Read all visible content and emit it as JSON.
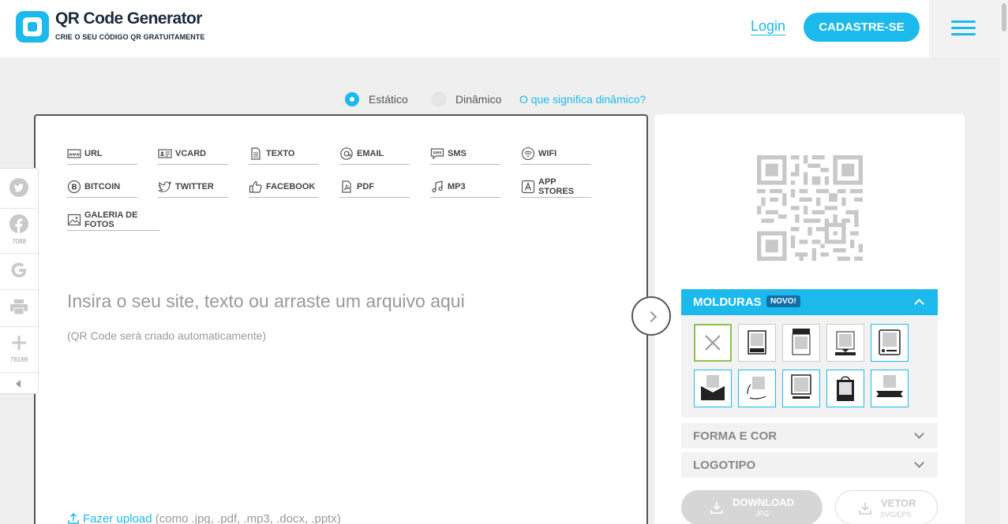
{
  "header": {
    "logo_title": "QR Code Generator",
    "logo_subtitle": "CRIE O SEU CÓDIGO QR GRATUITAMENTE",
    "login_label": "Login",
    "signup_label": "CADASTRE-SE",
    "accent_color": "#1cb9ec"
  },
  "mode": {
    "options": [
      "Estático",
      "Dinâmico"
    ],
    "selected": "Estático",
    "help_link": "O que significa dinâmico?"
  },
  "tabs": [
    {
      "label": "URL",
      "icon": "www-icon"
    },
    {
      "label": "VCARD",
      "icon": "vcard-icon"
    },
    {
      "label": "TEXTO",
      "icon": "document-icon"
    },
    {
      "label": "EMAIL",
      "icon": "at-icon"
    },
    {
      "label": "SMS",
      "icon": "sms-icon"
    },
    {
      "label": "WIFI",
      "icon": "wifi-icon"
    },
    {
      "label": "BITCOIN",
      "icon": "bitcoin-icon"
    },
    {
      "label": "TWITTER",
      "icon": "twitter-icon"
    },
    {
      "label": "FACEBOOK",
      "icon": "thumbs-up-icon"
    },
    {
      "label": "PDF",
      "icon": "pdf-icon"
    },
    {
      "label": "MP3",
      "icon": "music-note-icon"
    },
    {
      "label": "APP STORES",
      "icon": "app-store-icon"
    },
    {
      "label": "GALERIA DE FOTOS",
      "icon": "image-icon"
    }
  ],
  "editor": {
    "placeholder": "Insira o seu site, texto ou arraste um arquivo aqui",
    "subtext": "(QR Code será criado automaticamente)",
    "upload_link": "Fazer upload",
    "upload_hint": "(como .jpg, .pdf, .mp3, .docx, .pptx)"
  },
  "social": {
    "facebook_count": "7088",
    "share_count": "76169"
  },
  "customize": {
    "molduras_label": "MOLDURAS",
    "molduras_badge": "NOVO!",
    "forma_label": "FORMA E COR",
    "logotipo_label": "LOGOTIPO",
    "frame_count": 10
  },
  "downloads": {
    "download_label": "DOWNLOAD",
    "download_format": "JPG",
    "vector_label": "VETOR",
    "vector_format": "SVG/EPS"
  }
}
